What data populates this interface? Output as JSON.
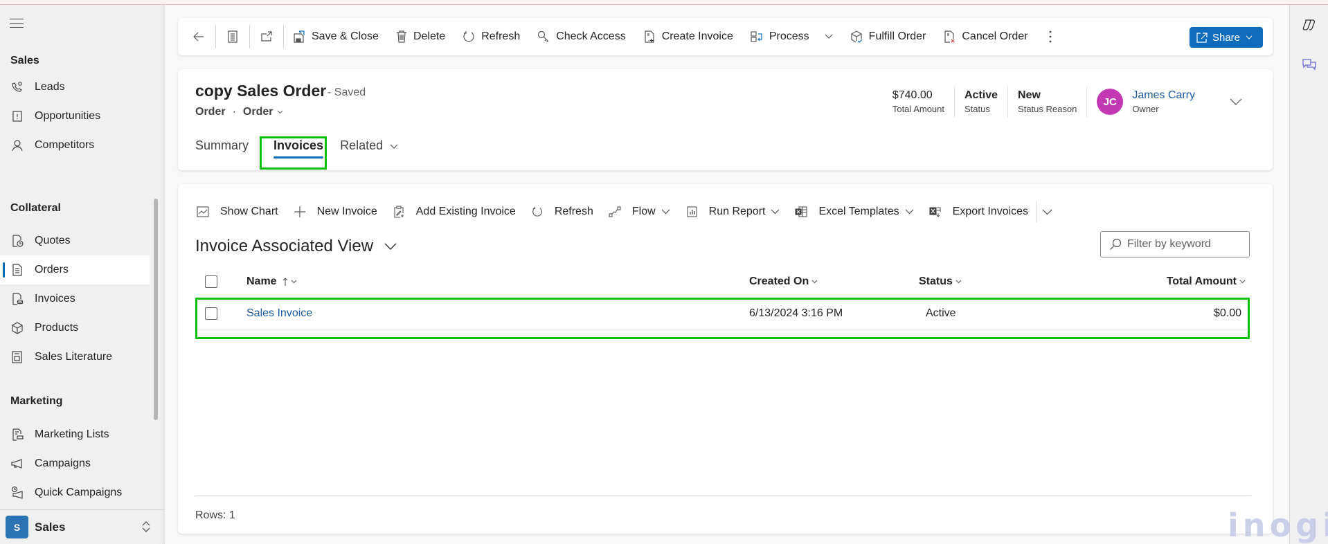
{
  "sidebar": {
    "groups": [
      {
        "title": "Sales",
        "items": [
          {
            "label": "Leads",
            "icon": "phone-gear-icon"
          },
          {
            "label": "Opportunities",
            "icon": "opportunity-icon"
          },
          {
            "label": "Competitors",
            "icon": "person-icon"
          }
        ]
      },
      {
        "title": "Collateral",
        "items": [
          {
            "label": "Quotes",
            "icon": "quote-clock-icon"
          },
          {
            "label": "Orders",
            "icon": "document-list-icon",
            "active": true
          },
          {
            "label": "Invoices",
            "icon": "invoice-icon"
          },
          {
            "label": "Products",
            "icon": "box-icon"
          },
          {
            "label": "Sales Literature",
            "icon": "literature-icon"
          }
        ]
      },
      {
        "title": "Marketing",
        "items": [
          {
            "label": "Marketing Lists",
            "icon": "marketing-list-icon"
          },
          {
            "label": "Campaigns",
            "icon": "megaphone-icon"
          },
          {
            "label": "Quick Campaigns",
            "icon": "quick-campaign-icon"
          }
        ]
      }
    ],
    "area": {
      "badge": "S",
      "name": "Sales"
    }
  },
  "command_bar": {
    "items": [
      {
        "label": "Save & Close",
        "icon": "save-icon"
      },
      {
        "label": "Delete",
        "icon": "trash-icon"
      },
      {
        "label": "Refresh",
        "icon": "refresh-icon"
      },
      {
        "label": "Check Access",
        "icon": "key-icon"
      },
      {
        "label": "Create Invoice",
        "icon": "create-invoice-icon"
      },
      {
        "label": "Process",
        "icon": "process-icon",
        "dropdown": true
      },
      {
        "label": "Fulfill Order",
        "icon": "fulfill-box-icon"
      },
      {
        "label": "Cancel Order",
        "icon": "cancel-doc-icon"
      }
    ],
    "share_label": "Share"
  },
  "record": {
    "title": "copy Sales Order",
    "save_state": "- Saved",
    "entity": "Order",
    "form": "Order",
    "tabs": [
      {
        "label": "Summary"
      },
      {
        "label": "Invoices",
        "active": true
      },
      {
        "label": "Related",
        "dropdown": true
      }
    ],
    "header_fields": [
      {
        "value": "$740.00",
        "label": "Total Amount"
      },
      {
        "value": "Active",
        "label": "Status"
      },
      {
        "value": "New",
        "label": "Status Reason"
      }
    ],
    "owner": {
      "initials": "JC",
      "name": "James Carry",
      "label": "Owner",
      "avatar_color": "#c239b3"
    }
  },
  "subgrid": {
    "commands": [
      {
        "label": "Show Chart",
        "icon": "chart-icon"
      },
      {
        "label": "New Invoice",
        "icon": "plus-icon"
      },
      {
        "label": "Add Existing Invoice",
        "icon": "clipboard-add-icon"
      },
      {
        "label": "Refresh",
        "icon": "refresh-icon"
      },
      {
        "label": "Flow",
        "icon": "flow-icon",
        "dropdown": true
      },
      {
        "label": "Run Report",
        "icon": "report-icon",
        "dropdown": true
      },
      {
        "label": "Excel Templates",
        "icon": "excel-icon",
        "dropdown": true
      },
      {
        "label": "Export Invoices",
        "icon": "excel-export-icon"
      }
    ],
    "view_name": "Invoice Associated View",
    "filter_placeholder": "Filter by keyword",
    "columns": [
      "Name",
      "Created On",
      "Status",
      "Total Amount"
    ],
    "sort": {
      "column": "Name",
      "direction": "ascending"
    },
    "rows": [
      {
        "name": "Sales Invoice",
        "created_on": "6/13/2024 3:16 PM",
        "status": "Active",
        "total_amount": "$0.00"
      }
    ],
    "rows_label": "Rows: 1"
  },
  "watermark": "inogic",
  "colors": {
    "accent": "#0f6cbd",
    "highlight": "#0bc00b",
    "link": "#1a5aa0"
  }
}
